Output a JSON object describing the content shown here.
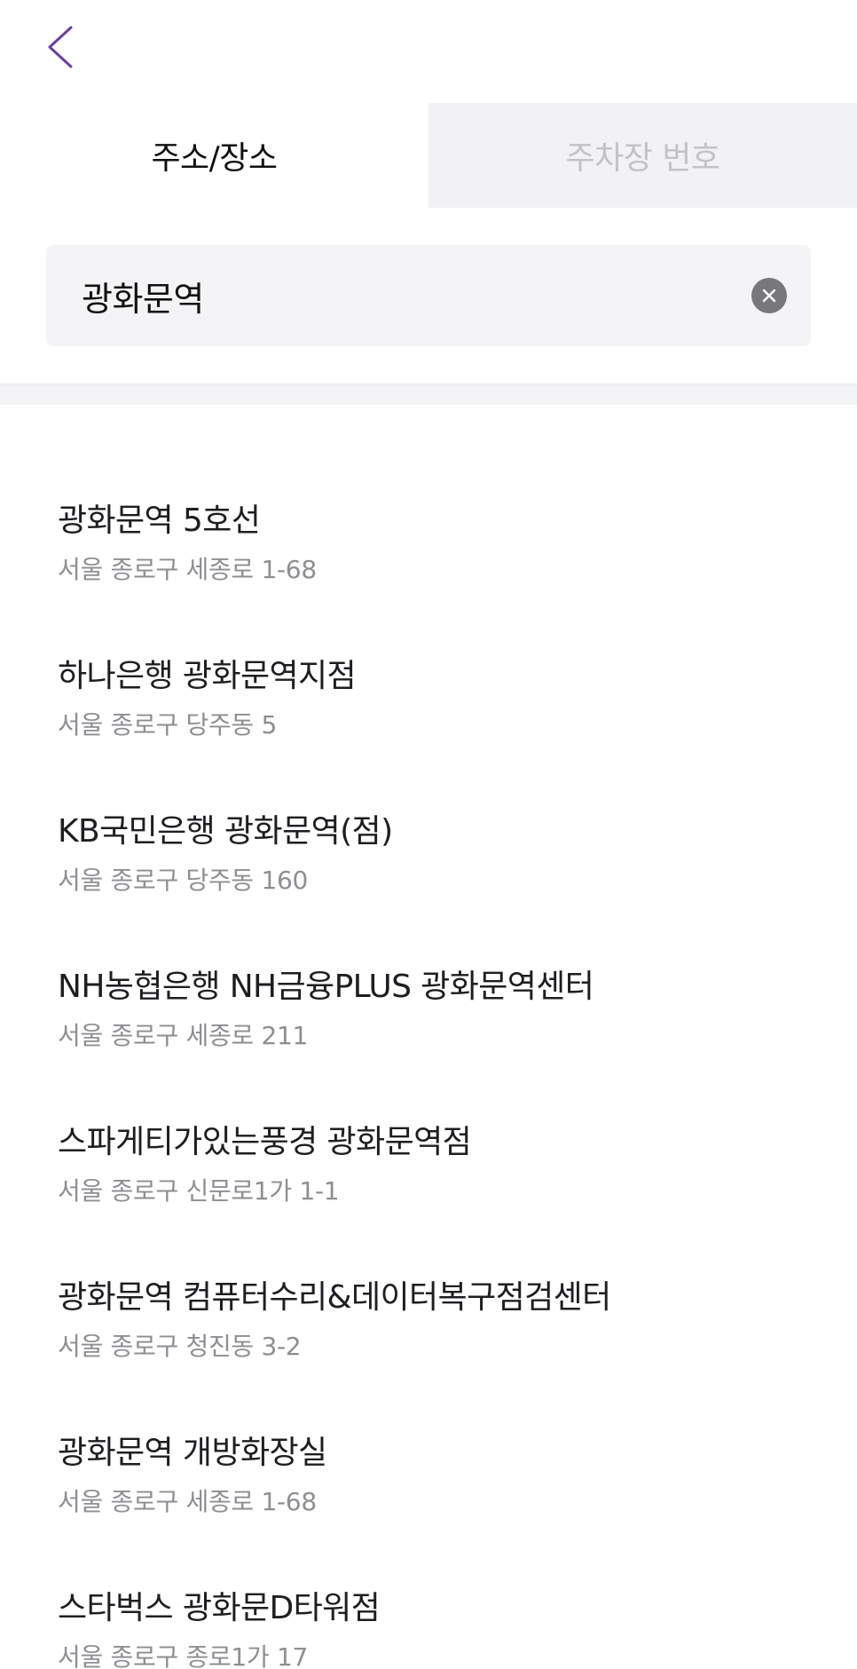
{
  "header": {
    "back_icon": "chevron-left-icon",
    "accent_color": "#6b3fa0"
  },
  "tabs": [
    {
      "label": "주소/장소",
      "active": true
    },
    {
      "label": "주차장 번호",
      "active": false
    }
  ],
  "search": {
    "value": "광화문역",
    "clear_icon": "clear-circle-icon"
  },
  "results": [
    {
      "title": "광화문역 5호선",
      "address": "서울 종로구 세종로 1-68"
    },
    {
      "title": "하나은행 광화문역지점",
      "address": "서울 종로구 당주동 5"
    },
    {
      "title": "KB국민은행 광화문역(점)",
      "address": "서울 종로구 당주동 160"
    },
    {
      "title": "NH농협은행 NH금융PLUS 광화문역센터",
      "address": "서울 종로구 세종로 211"
    },
    {
      "title": "스파게티가있는풍경 광화문역점",
      "address": "서울 종로구 신문로1가 1-1"
    },
    {
      "title": "광화문역 컴퓨터수리&데이터복구점검센터",
      "address": "서울 종로구 청진동 3-2"
    },
    {
      "title": "광화문역 개방화장실",
      "address": "서울 종로구 세종로 1-68"
    },
    {
      "title": "스타벅스 광화문D타워점",
      "address": "서울 종로구 종로1가 17"
    }
  ]
}
